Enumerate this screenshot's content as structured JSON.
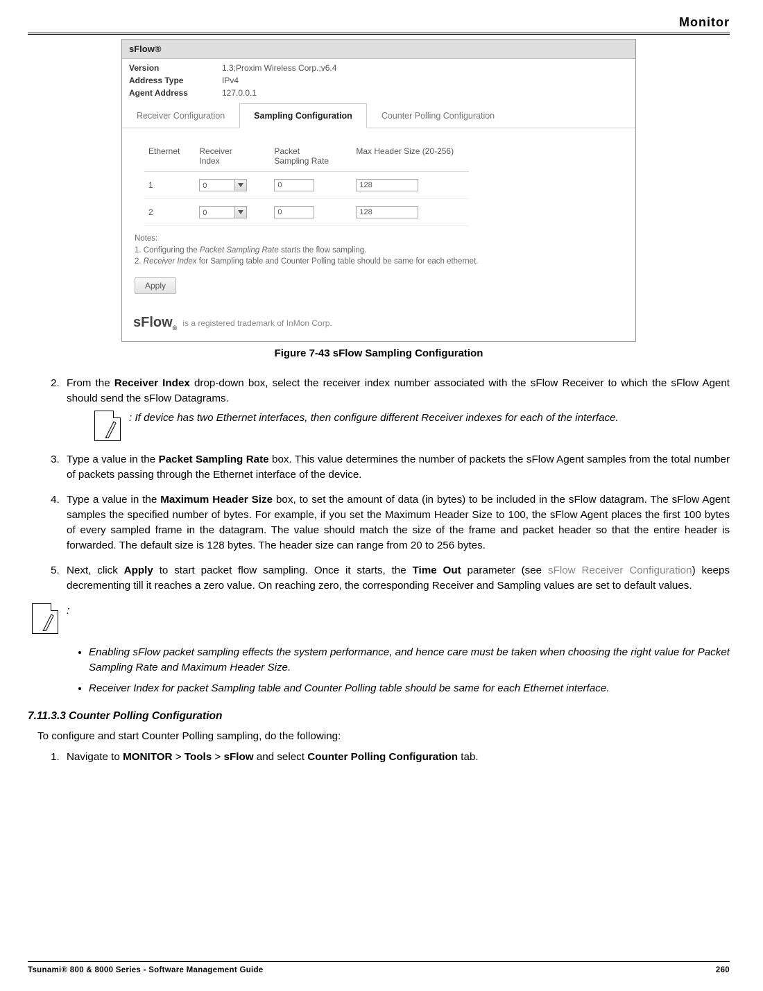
{
  "header": {
    "title": "Monitor"
  },
  "panel": {
    "title": "sFlow®",
    "kv": {
      "version_label": "Version",
      "version_value": "1.3;Proxim Wireless Corp.;v6.4",
      "addr_type_label": "Address Type",
      "addr_type_value": "IPv4",
      "agent_addr_label": "Agent Address",
      "agent_addr_value": "127.0.0.1"
    },
    "tabs": {
      "receiver": "Receiver Configuration",
      "sampling": "Sampling Configuration",
      "counter": "Counter Polling Configuration"
    },
    "grid": {
      "headers": {
        "ethernet": "Ethernet",
        "recv_idx": "Receiver Index",
        "psr": "Packet Sampling Rate",
        "maxhdr": "Max Header Size (20-256)"
      },
      "rows": [
        {
          "eth": "1",
          "idx": "0",
          "psr": "0",
          "max": "128"
        },
        {
          "eth": "2",
          "idx": "0",
          "psr": "0",
          "max": "128"
        }
      ]
    },
    "notes": {
      "title": "Notes:",
      "n1_pre": "1. Configuring the ",
      "n1_em": "Packet Sampling Rate",
      "n1_post": " starts the flow sampling.",
      "n2_pre": "2. ",
      "n2_em": "Receiver Index",
      "n2_post": " for Sampling table and Counter Polling table should be same for each ethernet."
    },
    "apply": "Apply",
    "trademark_logo": "sFlow",
    "trademark_text": "is a registered trademark of InMon Corp."
  },
  "figure_caption": "Figure 7-43 sFlow Sampling Configuration",
  "steps": {
    "s2_pre": "From the ",
    "s2_b": "Receiver Index",
    "s2_post": " drop-down box, select the receiver index number associated with the sFlow Receiver to which the sFlow Agent should send the sFlow Datagrams.",
    "note1": ": If device has two Ethernet interfaces, then configure different Receiver indexes for each of the interface.",
    "s3_pre": "Type a value in the ",
    "s3_b": "Packet Sampling Rate",
    "s3_post": " box. This value determines the number of packets the sFlow Agent samples from the total number of packets passing through the Ethernet interface of the device.",
    "s4_pre": "Type a value in the ",
    "s4_b": "Maximum Header Size",
    "s4_post": " box, to set the amount of data (in bytes) to be included in the sFlow datagram. The sFlow Agent samples the specified number of bytes. For example, if you set the Maximum Header Size to 100, the sFlow Agent places the first 100 bytes of every sampled frame in the datagram. The value should match the size of the frame and packet header so that the entire header is forwarded. The default size is 128 bytes. The header size can range from 20 to 256 bytes.",
    "s5_pre": "Next, click ",
    "s5_b1": "Apply",
    "s5_mid1": " to start packet flow sampling. Once it starts, the ",
    "s5_b2": "Time Out",
    "s5_mid2": " parameter (see ",
    "s5_link": "sFlow Receiver Configuration",
    "s5_post": ") keeps decrementing till it reaches a zero value. On reaching zero, the corresponding Receiver and Sampling values are set to default values."
  },
  "note_colon": ":",
  "bullets": {
    "b1": "Enabling sFlow packet sampling effects the system performance, and hence care must be taken when choosing the right value for Packet Sampling Rate and Maximum Header Size.",
    "b2": "Receiver Index for packet Sampling table and Counter Polling table should be same for each Ethernet interface."
  },
  "section": {
    "number": "7.11.3.3 Counter Polling Configuration",
    "intro": "To configure and start Counter Polling sampling, do the following:",
    "step1_pre": "Navigate to ",
    "step1_b1": "MONITOR",
    "step1_gt1": " > ",
    "step1_b2": "Tools",
    "step1_gt2": " > ",
    "step1_b3": "sFlow",
    "step1_mid": " and select ",
    "step1_b4": "Counter Polling Configuration",
    "step1_post": " tab."
  },
  "footer": {
    "left": "Tsunami® 800 & 8000 Series - Software Management Guide",
    "right": "260"
  }
}
